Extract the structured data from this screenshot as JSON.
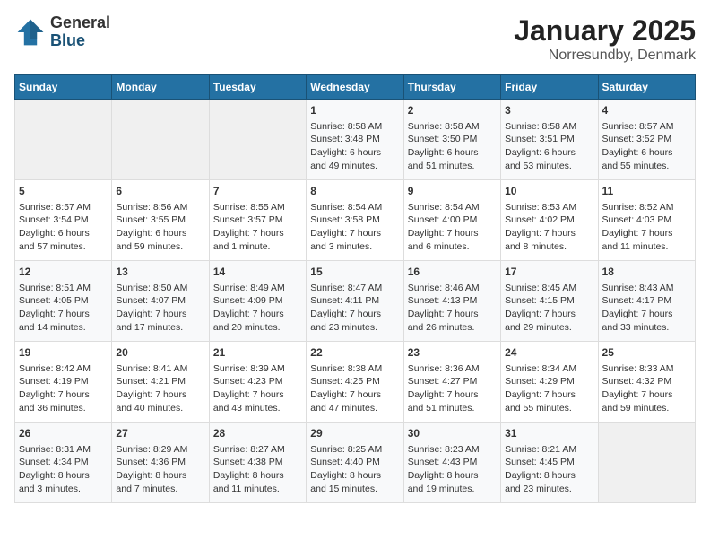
{
  "logo": {
    "general": "General",
    "blue": "Blue"
  },
  "title": "January 2025",
  "subtitle": "Norresundby, Denmark",
  "weekdays": [
    "Sunday",
    "Monday",
    "Tuesday",
    "Wednesday",
    "Thursday",
    "Friday",
    "Saturday"
  ],
  "weeks": [
    [
      {
        "day": "",
        "info": ""
      },
      {
        "day": "",
        "info": ""
      },
      {
        "day": "",
        "info": ""
      },
      {
        "day": "1",
        "info": "Sunrise: 8:58 AM\nSunset: 3:48 PM\nDaylight: 6 hours\nand 49 minutes."
      },
      {
        "day": "2",
        "info": "Sunrise: 8:58 AM\nSunset: 3:50 PM\nDaylight: 6 hours\nand 51 minutes."
      },
      {
        "day": "3",
        "info": "Sunrise: 8:58 AM\nSunset: 3:51 PM\nDaylight: 6 hours\nand 53 minutes."
      },
      {
        "day": "4",
        "info": "Sunrise: 8:57 AM\nSunset: 3:52 PM\nDaylight: 6 hours\nand 55 minutes."
      }
    ],
    [
      {
        "day": "5",
        "info": "Sunrise: 8:57 AM\nSunset: 3:54 PM\nDaylight: 6 hours\nand 57 minutes."
      },
      {
        "day": "6",
        "info": "Sunrise: 8:56 AM\nSunset: 3:55 PM\nDaylight: 6 hours\nand 59 minutes."
      },
      {
        "day": "7",
        "info": "Sunrise: 8:55 AM\nSunset: 3:57 PM\nDaylight: 7 hours\nand 1 minute."
      },
      {
        "day": "8",
        "info": "Sunrise: 8:54 AM\nSunset: 3:58 PM\nDaylight: 7 hours\nand 3 minutes."
      },
      {
        "day": "9",
        "info": "Sunrise: 8:54 AM\nSunset: 4:00 PM\nDaylight: 7 hours\nand 6 minutes."
      },
      {
        "day": "10",
        "info": "Sunrise: 8:53 AM\nSunset: 4:02 PM\nDaylight: 7 hours\nand 8 minutes."
      },
      {
        "day": "11",
        "info": "Sunrise: 8:52 AM\nSunset: 4:03 PM\nDaylight: 7 hours\nand 11 minutes."
      }
    ],
    [
      {
        "day": "12",
        "info": "Sunrise: 8:51 AM\nSunset: 4:05 PM\nDaylight: 7 hours\nand 14 minutes."
      },
      {
        "day": "13",
        "info": "Sunrise: 8:50 AM\nSunset: 4:07 PM\nDaylight: 7 hours\nand 17 minutes."
      },
      {
        "day": "14",
        "info": "Sunrise: 8:49 AM\nSunset: 4:09 PM\nDaylight: 7 hours\nand 20 minutes."
      },
      {
        "day": "15",
        "info": "Sunrise: 8:47 AM\nSunset: 4:11 PM\nDaylight: 7 hours\nand 23 minutes."
      },
      {
        "day": "16",
        "info": "Sunrise: 8:46 AM\nSunset: 4:13 PM\nDaylight: 7 hours\nand 26 minutes."
      },
      {
        "day": "17",
        "info": "Sunrise: 8:45 AM\nSunset: 4:15 PM\nDaylight: 7 hours\nand 29 minutes."
      },
      {
        "day": "18",
        "info": "Sunrise: 8:43 AM\nSunset: 4:17 PM\nDaylight: 7 hours\nand 33 minutes."
      }
    ],
    [
      {
        "day": "19",
        "info": "Sunrise: 8:42 AM\nSunset: 4:19 PM\nDaylight: 7 hours\nand 36 minutes."
      },
      {
        "day": "20",
        "info": "Sunrise: 8:41 AM\nSunset: 4:21 PM\nDaylight: 7 hours\nand 40 minutes."
      },
      {
        "day": "21",
        "info": "Sunrise: 8:39 AM\nSunset: 4:23 PM\nDaylight: 7 hours\nand 43 minutes."
      },
      {
        "day": "22",
        "info": "Sunrise: 8:38 AM\nSunset: 4:25 PM\nDaylight: 7 hours\nand 47 minutes."
      },
      {
        "day": "23",
        "info": "Sunrise: 8:36 AM\nSunset: 4:27 PM\nDaylight: 7 hours\nand 51 minutes."
      },
      {
        "day": "24",
        "info": "Sunrise: 8:34 AM\nSunset: 4:29 PM\nDaylight: 7 hours\nand 55 minutes."
      },
      {
        "day": "25",
        "info": "Sunrise: 8:33 AM\nSunset: 4:32 PM\nDaylight: 7 hours\nand 59 minutes."
      }
    ],
    [
      {
        "day": "26",
        "info": "Sunrise: 8:31 AM\nSunset: 4:34 PM\nDaylight: 8 hours\nand 3 minutes."
      },
      {
        "day": "27",
        "info": "Sunrise: 8:29 AM\nSunset: 4:36 PM\nDaylight: 8 hours\nand 7 minutes."
      },
      {
        "day": "28",
        "info": "Sunrise: 8:27 AM\nSunset: 4:38 PM\nDaylight: 8 hours\nand 11 minutes."
      },
      {
        "day": "29",
        "info": "Sunrise: 8:25 AM\nSunset: 4:40 PM\nDaylight: 8 hours\nand 15 minutes."
      },
      {
        "day": "30",
        "info": "Sunrise: 8:23 AM\nSunset: 4:43 PM\nDaylight: 8 hours\nand 19 minutes."
      },
      {
        "day": "31",
        "info": "Sunrise: 8:21 AM\nSunset: 4:45 PM\nDaylight: 8 hours\nand 23 minutes."
      },
      {
        "day": "",
        "info": ""
      }
    ]
  ]
}
